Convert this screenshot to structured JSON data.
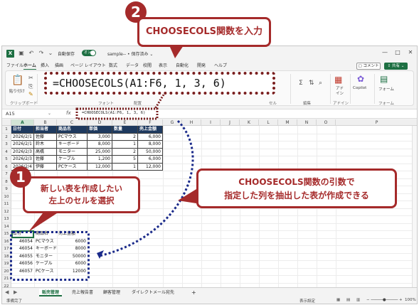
{
  "callouts": {
    "step2_number": "2",
    "step2_text": "CHOOSECOLS関数を入力",
    "step1_number": "1",
    "step1_text_line1": "新しい表を作成したい",
    "step1_text_line2": "左上のセルを選択",
    "result_line1": "CHOOSECOLS関数の引数で",
    "result_line2": "指定した列を抽出した表が作成できる",
    "formula_large": "=CHOOSECOLS(A1:F6, 1, 3, 6)",
    "accent_color": "#a52a2a"
  },
  "titlebar": {
    "app_icon": "X",
    "autosave_label": "自動保存",
    "autosave_state": "オン",
    "file_name": "sample-- • 保存済み ⌄",
    "icons": [
      "save-icon",
      "undo-icon",
      "redo-icon",
      "more-icon"
    ]
  },
  "menu": {
    "items": [
      "ファイル",
      "ホーム",
      "挿入",
      "描画",
      "ページ レイアウト",
      "数式",
      "データ",
      "校閲",
      "表示",
      "自動化",
      "開発",
      "ヘルプ"
    ],
    "active": "ホーム",
    "comment": "コメント",
    "share": "共有"
  },
  "ribbon": {
    "paste": "貼り付け",
    "clipboard": "クリップボード",
    "font": "フォント",
    "alignment": "配置",
    "cells": "セル",
    "editing": "編集",
    "design": "アド\nイン",
    "copilot": "Copilot",
    "forms": "フォーム",
    "addins_group": "アドイン",
    "forms_group": "フォーム",
    "design_label": "アド",
    "design_label2": "イン"
  },
  "formula_bar": {
    "name_box": "A15",
    "fx": "fx",
    "content": "=CHOOSECOLS(A1:F6, 1, 3, 6)"
  },
  "sheet": {
    "columns": [
      "A",
      "B",
      "C",
      "D",
      "E",
      "F",
      "G",
      "H",
      "I",
      "J",
      "K",
      "L",
      "M",
      "N",
      "O",
      "P"
    ],
    "rows": [
      "1",
      "2",
      "3",
      "4",
      "5",
      "6",
      "7",
      "8",
      "9",
      "10",
      "11",
      "12",
      "13",
      "14",
      "15",
      "16",
      "17",
      "18",
      "19",
      "20",
      "21",
      "22"
    ],
    "source_table": {
      "headers": [
        "日付",
        "担当者",
        "商品名",
        "単価",
        "数量",
        "売上金額"
      ],
      "rows": [
        [
          "2026/2/1",
          "佐藤",
          "PCマウス",
          "3,000",
          "2",
          "6,000"
        ],
        [
          "2026/2/1",
          "鈴木",
          "キーボード",
          "8,000",
          "1",
          "8,000"
        ],
        [
          "2026/2/3",
          "高橋",
          "モニター",
          "25,000",
          "2",
          "50,000"
        ],
        [
          "2026/2/3",
          "佐藤",
          "ケーブル",
          "1,200",
          "5",
          "6,000"
        ],
        [
          "2026/2/4",
          "伊藤",
          "PCケース",
          "12,000",
          "1",
          "12,000"
        ]
      ]
    },
    "result_table": {
      "headers": [
        "日付",
        "商品名",
        "売上金額"
      ],
      "rows": [
        [
          "46054",
          "PCマウス",
          "6000"
        ],
        [
          "46054",
          "キーボード",
          "8000"
        ],
        [
          "46055",
          "モニター",
          "50000"
        ],
        [
          "46056",
          "ケーブル",
          "6000"
        ],
        [
          "46057",
          "PCケース",
          "12000"
        ]
      ]
    }
  },
  "tabs": {
    "items": [
      "販売管理",
      "売上報告書",
      "顧客管理",
      "ダイレクトメール宛先"
    ],
    "active": "販売管理",
    "add": "+"
  },
  "status": {
    "ready": "準備完了",
    "display_settings": "表示設定",
    "zoom": "100%"
  }
}
